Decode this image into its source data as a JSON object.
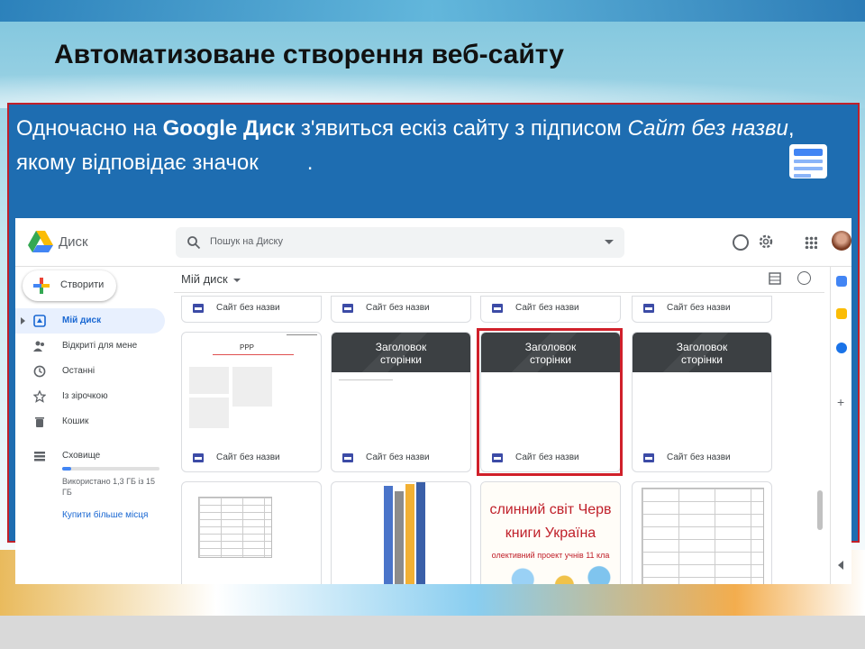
{
  "slide": {
    "title": "Автоматизоване створення веб-сайту",
    "text_part1": "Одночасно на ",
    "text_bold": "Google Диск",
    "text_part2": " з'явиться ескіз сайту з підписом ",
    "text_italic": "Сайт без назви",
    "text_part3": ", якому відповідає значок",
    "text_end": "."
  },
  "drive": {
    "app_name": "Диск",
    "search_placeholder": "Пошук на Диску",
    "new_button": "Створити",
    "nav": [
      {
        "label": "Мій диск",
        "icon": "drive-icon",
        "active": true
      },
      {
        "label": "Відкриті для мене",
        "icon": "shared-icon",
        "active": false
      },
      {
        "label": "Останні",
        "icon": "clock-icon",
        "active": false
      },
      {
        "label": "Із зірочкою",
        "icon": "star-icon",
        "active": false
      },
      {
        "label": "Кошик",
        "icon": "trash-icon",
        "active": false
      },
      {
        "label": "Сховище",
        "icon": "storage-icon",
        "active": false
      }
    ],
    "storage_text": "Використано 1,3 ГБ із 15 ГБ",
    "storage_fraction": 0.09,
    "buy_storage": "Купити більше місця",
    "breadcrumb": "Мій диск",
    "file_name": "Сайт без назви",
    "thumb_heading_1": "Заголовок",
    "thumb_heading_2": "сторінки",
    "thumb_ppp": "PPP",
    "thumb_red_1": "слинний світ Черв",
    "thumb_red_2": "книги Україна",
    "thumb_red_3": "олективний проект учнів 11 кла"
  },
  "colors": {
    "panel_blue": "#1e6db1",
    "highlight_red": "#d0202a",
    "drive_active": "#1967d2"
  }
}
